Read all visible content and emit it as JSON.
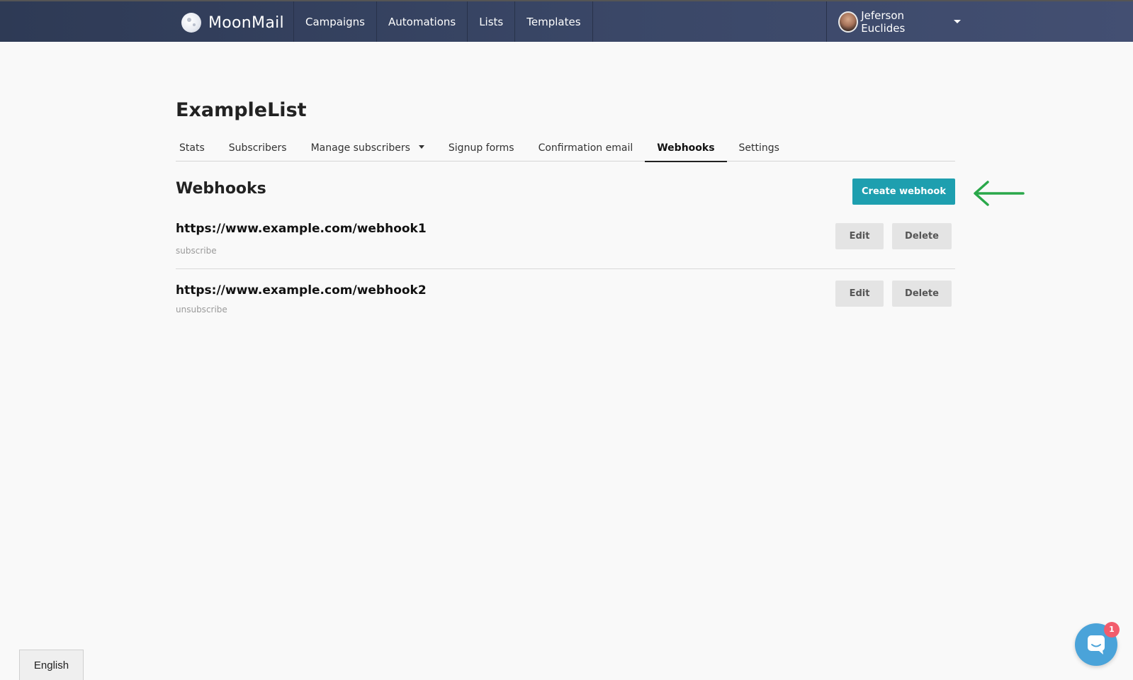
{
  "header": {
    "brand": "MoonMail",
    "nav": [
      "Campaigns",
      "Automations",
      "Lists",
      "Templates"
    ],
    "user_name": "Jeferson Euclides"
  },
  "list": {
    "title": "ExampleList",
    "tabs": [
      "Stats",
      "Subscribers",
      "Manage subscribers",
      "Signup forms",
      "Confirmation email",
      "Webhooks",
      "Settings"
    ],
    "active_tab": "Webhooks"
  },
  "webhooks": {
    "title": "Webhooks",
    "create_label": "Create webhook",
    "edit_label": "Edit",
    "delete_label": "Delete",
    "items": [
      {
        "url": "https://www.example.com/webhook1",
        "event": "subscribe"
      },
      {
        "url": "https://www.example.com/webhook2",
        "event": "unsubscribe"
      }
    ]
  },
  "footer": {
    "language": "English",
    "chat_badge": "1"
  },
  "colors": {
    "navbar": "#3a4767",
    "primary_button": "#1e9faf",
    "annotation_arrow": "#2aa84a",
    "chat": "#4aa3d9",
    "badge": "#f25c6c"
  }
}
